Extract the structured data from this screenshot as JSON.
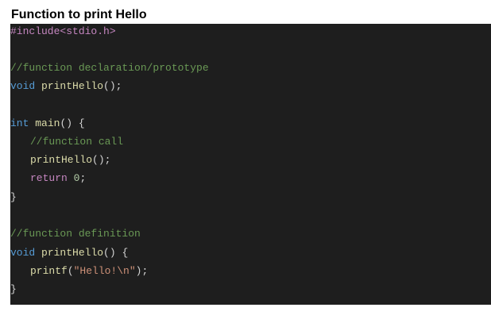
{
  "heading": "Function to print Hello",
  "code": {
    "include": "#include<stdio.h>",
    "comment_declaration": "//function declaration/prototype",
    "decl_void": "void",
    "decl_name": "printHello",
    "decl_tail": "();",
    "main_int": "int",
    "main_name": "main",
    "main_tail": "() {",
    "comment_call": "//function call",
    "call_name": "printHello",
    "call_tail": "();",
    "return_kw": "return",
    "return_val": "0",
    "return_tail": ";",
    "close_brace_1": "}",
    "comment_definition": "//function definition",
    "def_void": "void",
    "def_name": "printHello",
    "def_tail": "() {",
    "printf_name": "printf",
    "printf_open": "(",
    "printf_str": "\"Hello!\\n\"",
    "printf_close": ");",
    "close_brace_2": "}"
  }
}
